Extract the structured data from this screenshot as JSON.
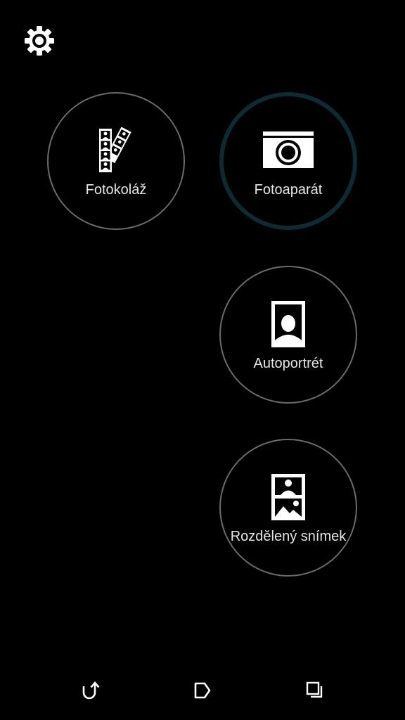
{
  "icons": {
    "settings": "gear-icon",
    "collage": "photo-strip-icon",
    "camera": "camera-icon",
    "selfie": "portrait-icon",
    "split": "split-frame-icon",
    "back": "back-arrow-icon",
    "home": "home-tag-icon",
    "recents": "recent-apps-icon"
  },
  "colors": {
    "background": "#000000",
    "ring": "#6b6b6b",
    "active_ring": "#0c2b33",
    "label": "#e6e6e6",
    "icon": "#ffffff"
  },
  "modes": {
    "collage": {
      "label": "Fotokoláž",
      "selected": false
    },
    "camera": {
      "label": "Fotoaparát",
      "selected": true
    },
    "selfie": {
      "label": "Autoportrét",
      "selected": false
    },
    "split": {
      "label": "Rozdělený snímek",
      "selected": false
    }
  }
}
